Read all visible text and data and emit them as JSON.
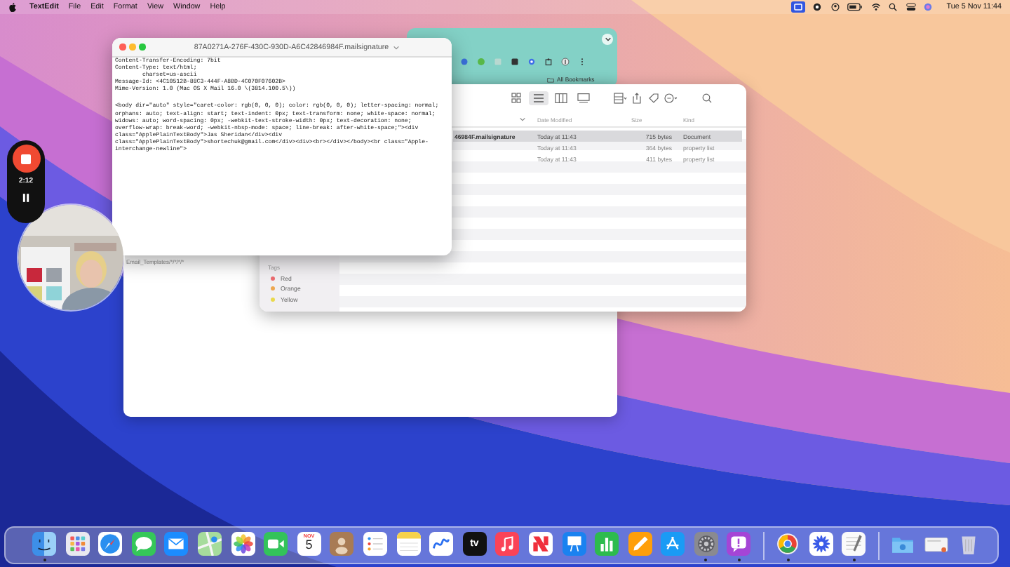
{
  "menu_bar": {
    "app": "TextEdit",
    "menus": [
      "File",
      "Edit",
      "Format",
      "View",
      "Window",
      "Help"
    ],
    "clock": "Tue 5 Nov 11:44"
  },
  "recorder": {
    "time": "2:12"
  },
  "browser_window": {
    "bookmarks": "All Bookmarks"
  },
  "blank_window": {
    "text": "Email_Templates/*/*/*/*"
  },
  "finder": {
    "views": [
      {
        "kind": "icons",
        "selected": false
      },
      {
        "kind": "list",
        "selected": true
      },
      {
        "kind": "columns",
        "selected": false
      },
      {
        "kind": "gallery",
        "selected": false
      }
    ],
    "columns": [
      "Date Modified",
      "Size",
      "Kind"
    ],
    "rows": [
      {
        "name": "46984F.mailsignature",
        "date": "Today at 11:43",
        "size": "715 bytes",
        "kind": "Document",
        "selected": true
      },
      {
        "date": "Today at 11:43",
        "size": "364 bytes",
        "kind": "property list",
        "selected": false
      },
      {
        "date": "Today at 11:43",
        "size": "411 bytes",
        "kind": "property list",
        "selected": false
      }
    ],
    "sidebar": {
      "heading": "Tags",
      "tags": [
        {
          "label": "Red",
          "color": "#ec6b70"
        },
        {
          "label": "Orange",
          "color": "#eda750"
        },
        {
          "label": "Yellow",
          "color": "#e9d94c"
        }
      ]
    }
  },
  "editor": {
    "title": "87A0271A-276F-430C-930D-A6C42846984F.mailsignature",
    "headers": [
      "Content-Transfer-Encoding: 7bit",
      "Content-Type: text/html;",
      "\tcharset=us-ascii",
      "Message-Id: <4C10512B-88C3-444F-A8BD-4C070F07602B>",
      "Mime-Version: 1.0 (Mac OS X Mail 16.0 \\(3814.100.5\\))"
    ],
    "body": [
      "<body dir=\"auto\" style=\"caret-color: rgb(0, 0, 0); color: rgb(0, 0, 0); letter-spacing: normal;",
      "orphans: auto; text-align: start; text-indent: 0px; text-transform: none; white-space: normal;",
      "widows: auto; word-spacing: 0px; -webkit-text-stroke-width: 0px; text-decoration: none;",
      "overflow-wrap: break-word; -webkit-nbsp-mode: space; line-break: after-white-space;\"><div",
      "class=\"ApplePlainTextBody\">Jas Sheridan</div><div",
      "class=\"ApplePlainTextBody\">shortechuk@gmail.com</div><div><br></div></body><br class=\"Apple-",
      "interchange-newline\">"
    ]
  },
  "dock": {
    "groups": [
      [
        {
          "kind": "finder",
          "running": true
        },
        {
          "kind": "launchpad",
          "running": false
        },
        {
          "kind": "safari",
          "running": false
        },
        {
          "kind": "messages",
          "running": false
        },
        {
          "kind": "mail",
          "running": false
        },
        {
          "kind": "maps",
          "running": false
        },
        {
          "kind": "photos",
          "running": false
        },
        {
          "kind": "facetime",
          "running": false
        },
        {
          "kind": "calendar",
          "running": false,
          "month": "NOV",
          "day": "5"
        },
        {
          "kind": "contacts",
          "running": false
        },
        {
          "kind": "reminders",
          "running": false
        },
        {
          "kind": "notes",
          "running": false
        },
        {
          "kind": "freeform",
          "running": false
        },
        {
          "kind": "tv",
          "running": false,
          "label": "tv"
        },
        {
          "kind": "music",
          "running": false
        },
        {
          "kind": "news",
          "running": false
        },
        {
          "kind": "keynote",
          "running": false
        },
        {
          "kind": "numbers",
          "running": false
        },
        {
          "kind": "pages",
          "running": false
        },
        {
          "kind": "appstore",
          "running": false
        },
        {
          "kind": "settings",
          "running": true
        },
        {
          "kind": "feedback",
          "running": true
        }
      ],
      [
        {
          "kind": "chrome",
          "running": true
        },
        {
          "kind": "flower",
          "running": false
        },
        {
          "kind": "textedit",
          "running": true
        }
      ],
      [
        {
          "kind": "downloads",
          "running": false
        },
        {
          "kind": "screenshot",
          "running": false
        },
        {
          "kind": "trash",
          "running": false
        }
      ]
    ]
  }
}
